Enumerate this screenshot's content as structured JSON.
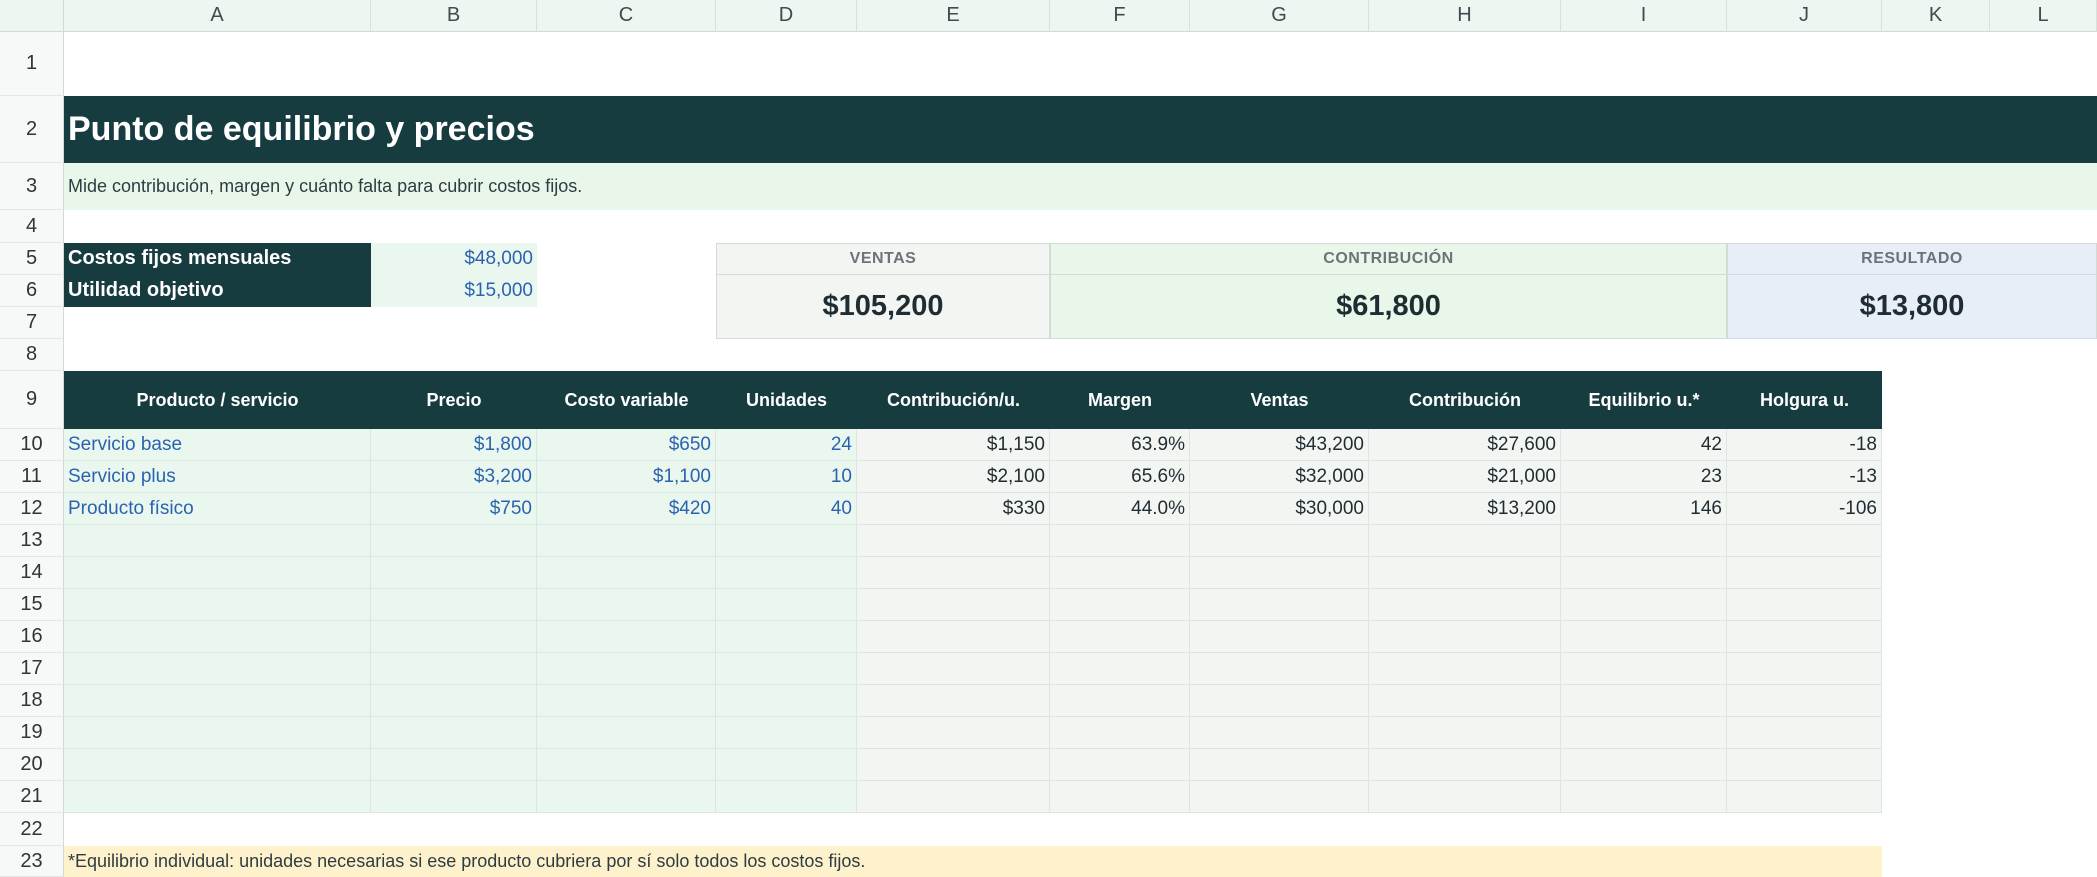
{
  "columns": [
    "A",
    "B",
    "C",
    "D",
    "E",
    "F",
    "G",
    "H",
    "I",
    "J",
    "K",
    "L"
  ],
  "rows": [
    "1",
    "2",
    "3",
    "4",
    "5",
    "6",
    "7",
    "8",
    "9",
    "10",
    "11",
    "12",
    "13",
    "14",
    "15",
    "16",
    "17",
    "18",
    "19",
    "20",
    "21",
    "22",
    "23"
  ],
  "title": "Punto de equilibrio y precios",
  "subtitle": "Mide contribución, margen y cuánto falta para cubrir costos fijos.",
  "params": [
    {
      "label": "Costos fijos mensuales",
      "value": "$48,000"
    },
    {
      "label": "Utilidad objetivo",
      "value": "$15,000"
    }
  ],
  "kpis": [
    {
      "label": "VENTAS",
      "value": "$105,200",
      "bg": "#f3f5f3"
    },
    {
      "label": "CONTRIBUCIÓN",
      "value": "$61,800",
      "bg": "#e8f7ea"
    },
    {
      "label": "RESULTADO",
      "value": "$13,800",
      "bg": "#e8eef8"
    }
  ],
  "table": {
    "headers": [
      "Producto / servicio",
      "Precio",
      "Costo variable",
      "Unidades",
      "Contribución/u.",
      "Margen",
      "Ventas",
      "Contribución",
      "Equilibrio u.*",
      "Holgura u."
    ],
    "rows": [
      [
        "Servicio base",
        "$1,800",
        "$650",
        "24",
        "$1,150",
        "63.9%",
        "$43,200",
        "$27,600",
        "42",
        "-18"
      ],
      [
        "Servicio plus",
        "$3,200",
        "$1,100",
        "10",
        "$2,100",
        "65.6%",
        "$32,000",
        "$21,000",
        "23",
        "-13"
      ],
      [
        "Producto físico",
        "$750",
        "$420",
        "40",
        "$330",
        "44.0%",
        "$30,000",
        "$13,200",
        "146",
        "-106"
      ]
    ],
    "empty_rows": 9
  },
  "footnote": "*Equilibrio individual: unidades necesarias si ese producto cubriera por sí solo todos los costos fijos.",
  "colors": {
    "dark_teal": "#173c40",
    "input_blue": "#2b63b0",
    "input_green_bg": "#eaf7ee",
    "note_yellow": "#fdf2cc"
  }
}
